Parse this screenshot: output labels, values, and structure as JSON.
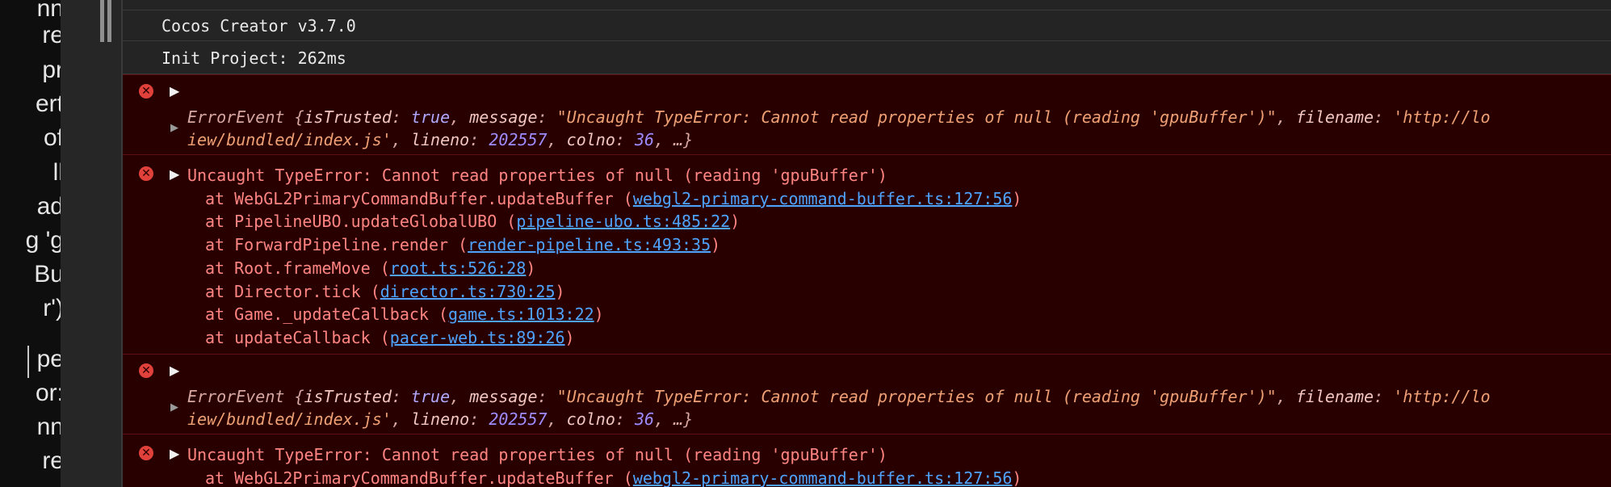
{
  "left_panel": {
    "lines": [
      "nn",
      "re",
      "pr",
      "ert",
      "of",
      "ll",
      "ad",
      "g 'g",
      "Bu",
      "r')",
      "pe",
      "or:",
      "nn",
      "re"
    ]
  },
  "console": {
    "logs": [
      "Cocos Creator v3.7.0",
      "Init Project: 262ms"
    ],
    "error_event": {
      "prefix": "ErrorEvent {",
      "k_isTrusted": "isTrusted",
      "v_isTrusted": "true",
      "k_message": "message",
      "v_message": "\"Uncaught TypeError: Cannot read properties of null (reading 'gpuBuffer')\"",
      "k_filename": "filename",
      "v_filename_start": "'http://lo",
      "v_filename_cont": "iew/bundled/index.js'",
      "k_lineno": "lineno",
      "v_lineno": "202557",
      "k_colno": "colno",
      "v_colno": "36",
      "tail": ", …}"
    },
    "error_message": "Uncaught TypeError: Cannot read properties of null (reading 'gpuBuffer')",
    "stack": [
      {
        "fn": "at WebGL2PrimaryCommandBuffer.updateBuffer (",
        "loc": "webgl2-primary-command-buffer.ts:127:56",
        "end": ")"
      },
      {
        "fn": "at PipelineUBO.updateGlobalUBO (",
        "loc": "pipeline-ubo.ts:485:22",
        "end": ")"
      },
      {
        "fn": "at ForwardPipeline.render (",
        "loc": "render-pipeline.ts:493:35",
        "end": ")"
      },
      {
        "fn": "at Root.frameMove (",
        "loc": "root.ts:526:28",
        "end": ")"
      },
      {
        "fn": "at Director.tick (",
        "loc": "director.ts:730:25",
        "end": ")"
      },
      {
        "fn": "at Game._updateCallback (",
        "loc": "game.ts:1013:22",
        "end": ")"
      },
      {
        "fn": "at updateCallback (",
        "loc": "pacer-web.ts:89:26",
        "end": ")"
      }
    ],
    "icons": {
      "error": "error-circle-icon",
      "expand": "expand-triangle-icon"
    },
    "colors": {
      "error_bg": "#290000",
      "error_text": "#ff8583",
      "link": "#4ea3ff"
    }
  }
}
